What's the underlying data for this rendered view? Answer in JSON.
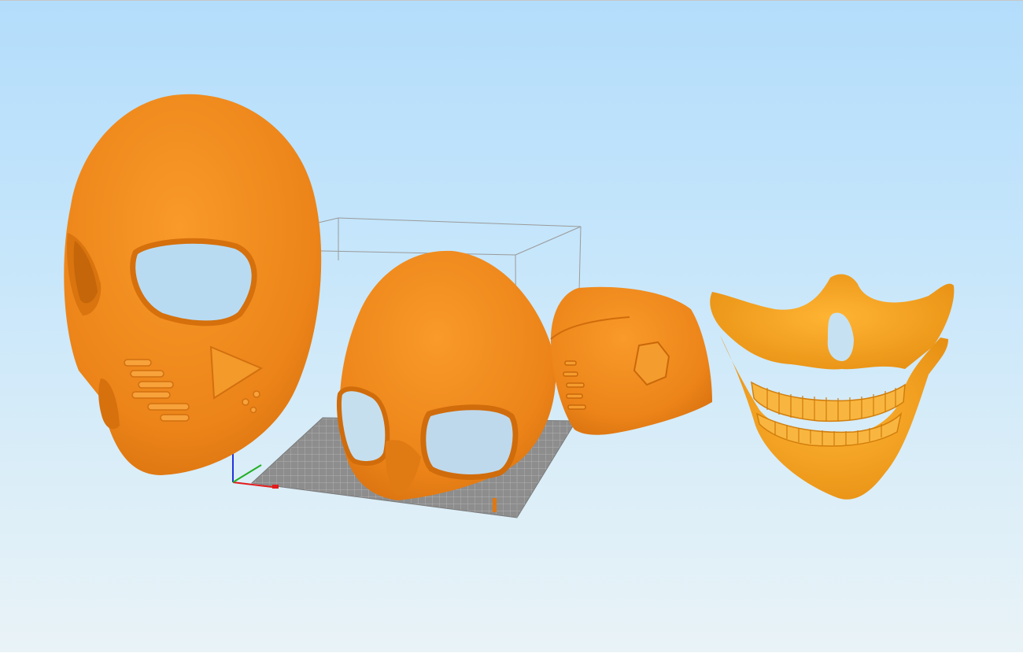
{
  "viewport": {
    "background_top": "#b3ddfb",
    "background_bottom": "#e9f3f7",
    "model_color": "#f28c1c",
    "skull_color": "#f6a21e"
  },
  "objects": [
    {
      "name": "full-face-mask"
    },
    {
      "name": "skull-cap-with-eye-openings"
    },
    {
      "name": "rear-head-piece"
    },
    {
      "name": "skull-jaw-mask"
    }
  ],
  "build_volume": {
    "grid": true,
    "color": "#9a9a9a"
  },
  "axes": {
    "x_color": "#e21b1b",
    "y_color": "#22b022",
    "z_color": "#2233dd"
  }
}
